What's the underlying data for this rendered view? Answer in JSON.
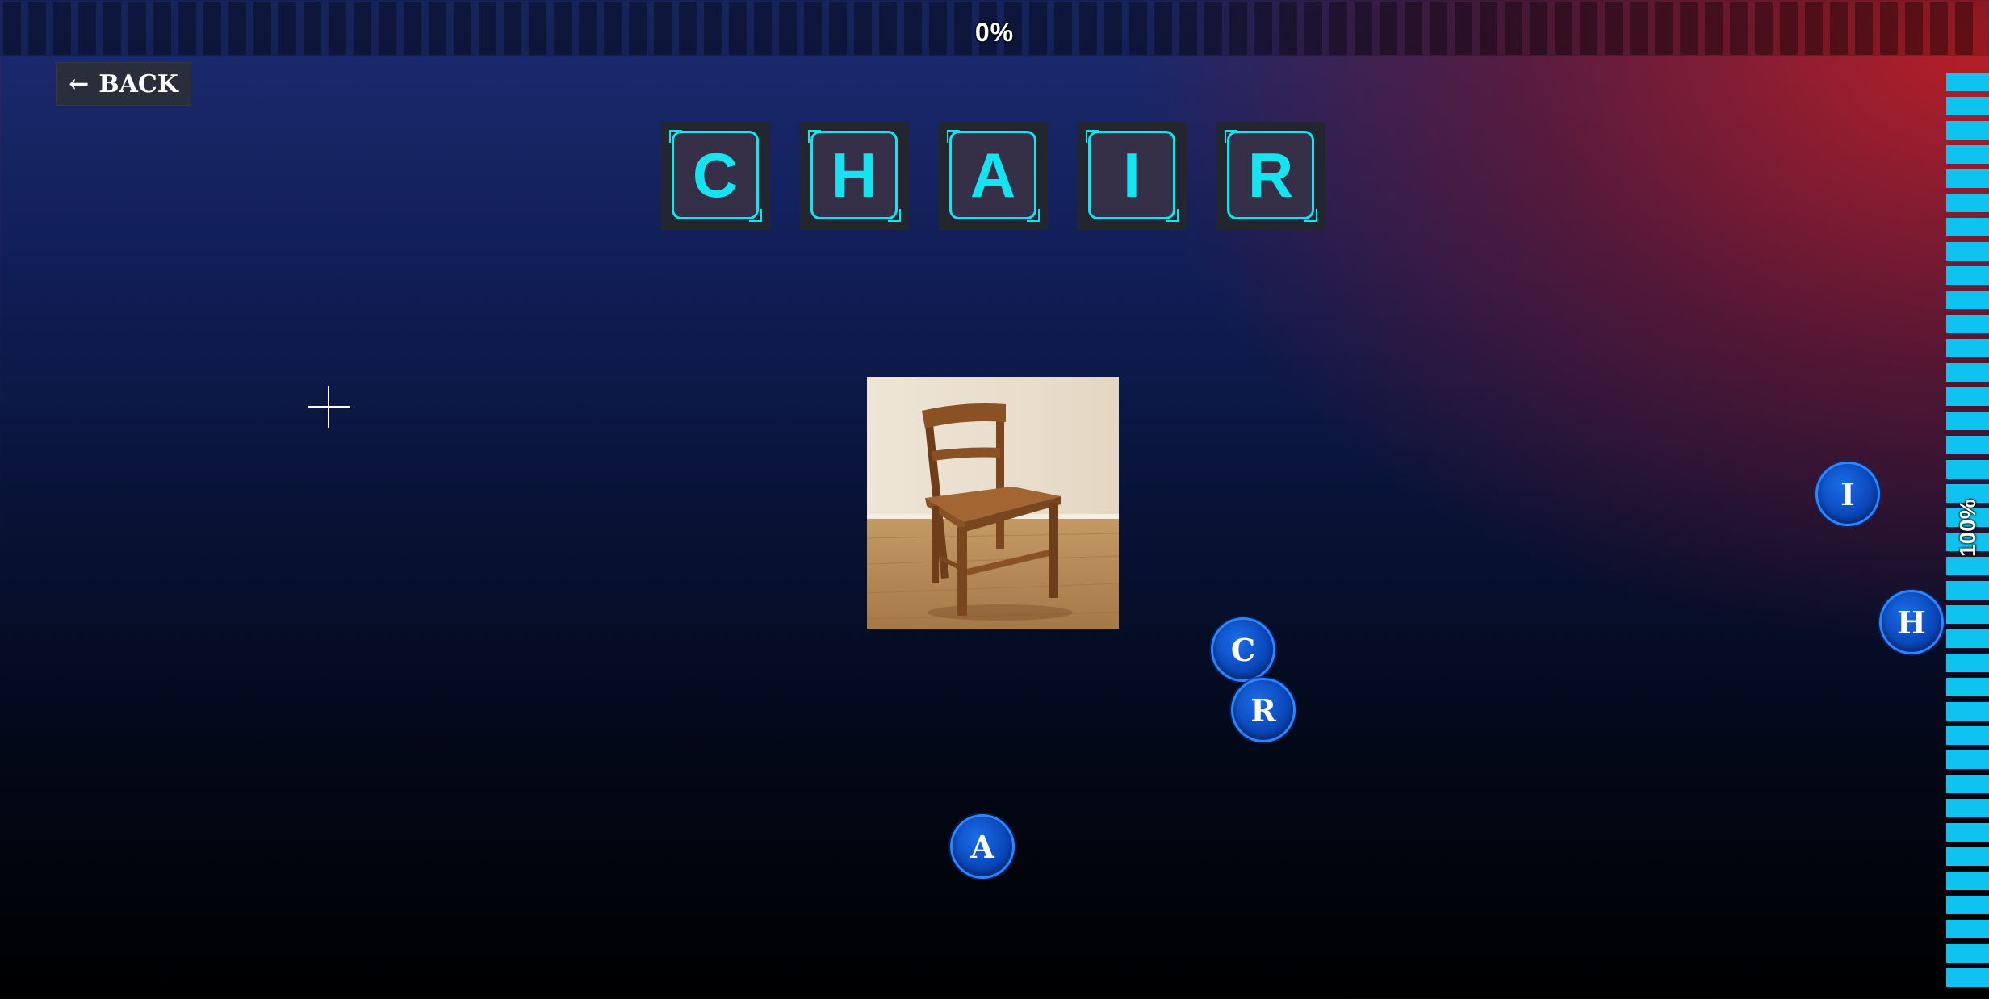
{
  "top_progress": {
    "label": "0%",
    "value": 0
  },
  "back_button": {
    "arrow": "←",
    "label": "BACK"
  },
  "target_word": "CHAIR",
  "slots": [
    {
      "letter": "C"
    },
    {
      "letter": "H"
    },
    {
      "letter": "A"
    },
    {
      "letter": "I"
    },
    {
      "letter": "R"
    }
  ],
  "picture": {
    "subject": "wooden chair"
  },
  "bubbles": [
    {
      "letter": "I"
    },
    {
      "letter": "H"
    },
    {
      "letter": "C"
    },
    {
      "letter": "R"
    },
    {
      "letter": "A"
    }
  ],
  "right_meter": {
    "label": "100%",
    "value": 100
  },
  "colors": {
    "accent_cyan": "#14e4f0",
    "meter_cyan": "#0fc3f0",
    "bubble_blue": "#0a46b8"
  }
}
